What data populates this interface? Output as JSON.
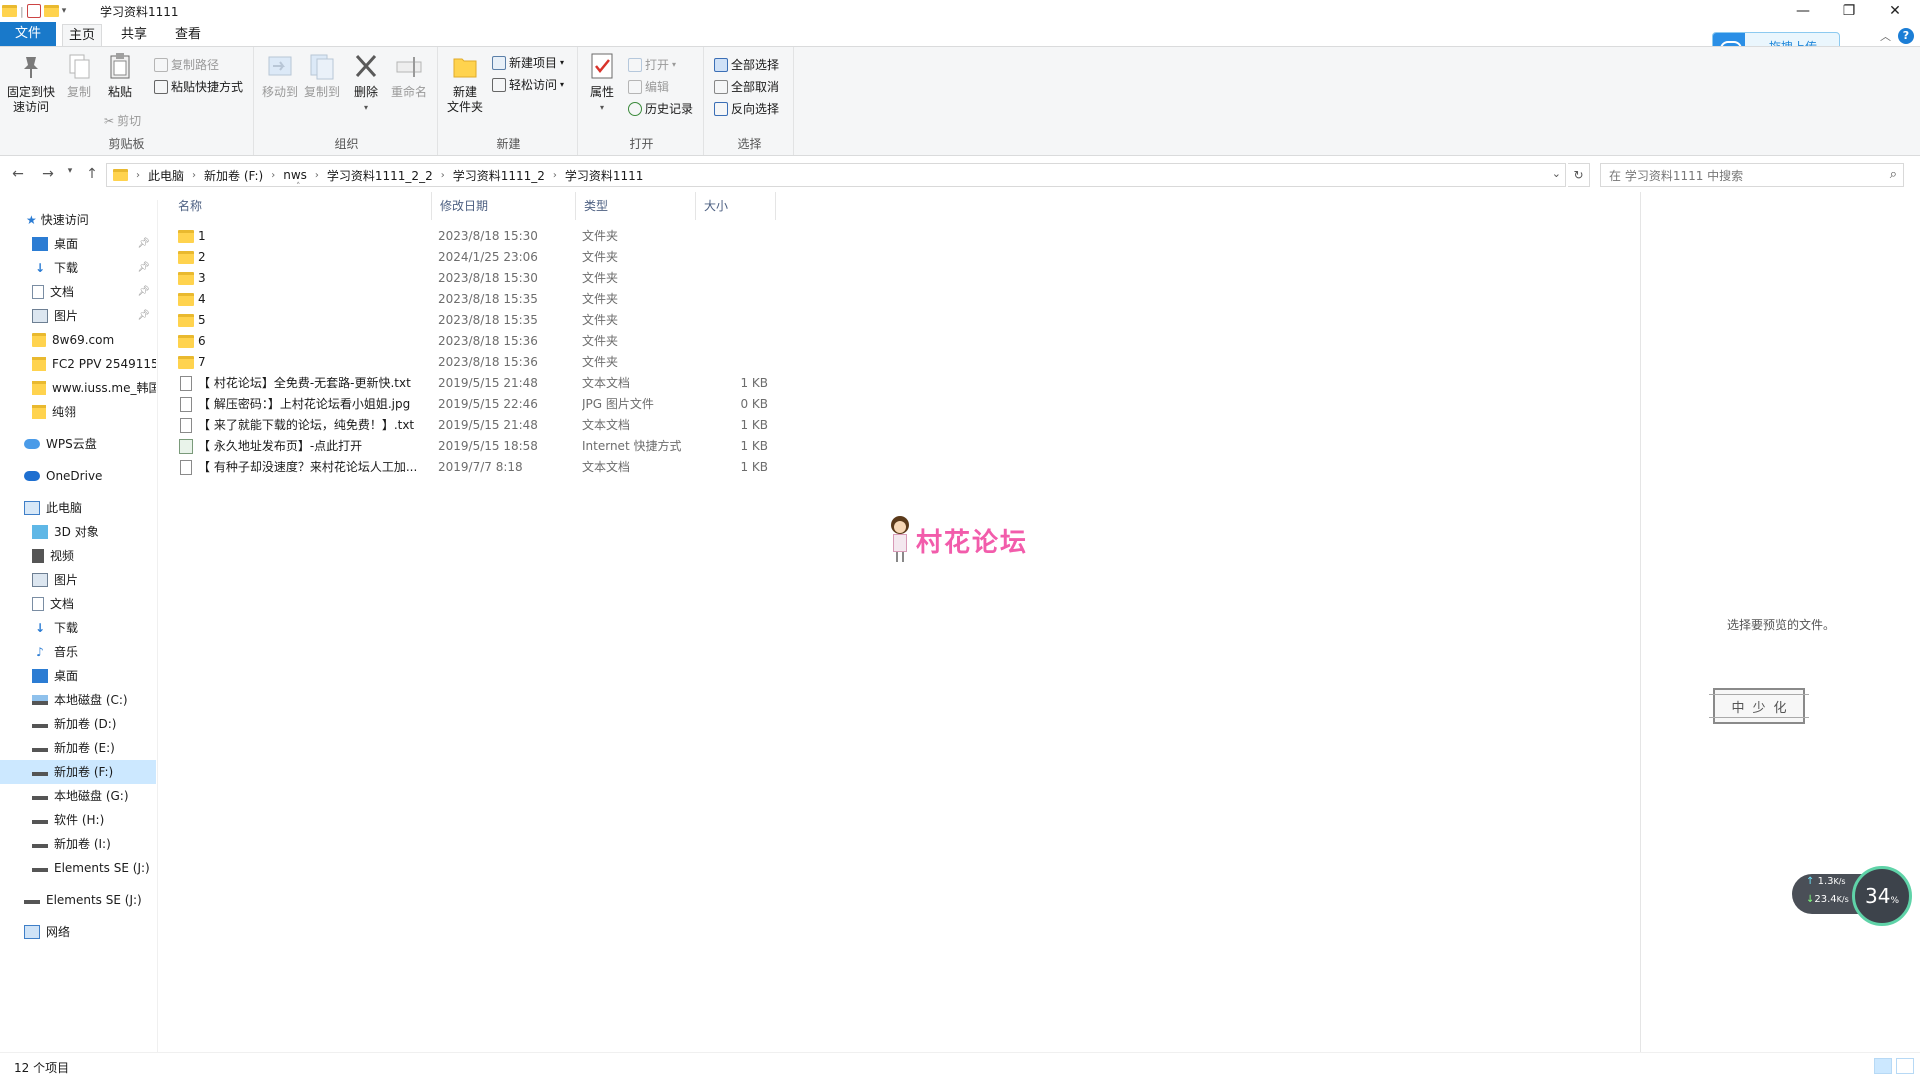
{
  "window": {
    "title": "学习资料1111",
    "minimize": "—",
    "maximize": "❐",
    "close": "✕"
  },
  "ribbon_tabs": [
    "文件",
    "主页",
    "共享",
    "查看"
  ],
  "ribbon": {
    "clipboard": {
      "label": "剪贴板",
      "pin_quick_access": "固定到快\n速访问",
      "copy": "复制",
      "paste": "粘贴",
      "copy_path": "复制路径",
      "paste_shortcut": "粘贴快捷方式",
      "cut": "剪切"
    },
    "organize": {
      "label": "组织",
      "move_to": "移动到",
      "copy_to": "复制到",
      "delete": "删除",
      "rename": "重命名"
    },
    "new": {
      "label": "新建",
      "new_folder": "新建\n文件夹",
      "new_item": "新建项目",
      "easy_access": "轻松访问"
    },
    "open": {
      "label": "打开",
      "properties": "属性",
      "open": "打开",
      "edit": "编辑",
      "history": "历史记录"
    },
    "select": {
      "label": "选择",
      "select_all": "全部选择",
      "select_none": "全部取消",
      "invert": "反向选择"
    }
  },
  "upload_button": "拖拽上传",
  "address": {
    "crumbs": [
      "此电脑",
      "新加卷 (F:)",
      "nws",
      "学习资料1111_2_2",
      "学习资料1111_2",
      "学习资料1111"
    ],
    "search_placeholder": "在 学习资料1111 中搜索"
  },
  "sidebar": {
    "quick_access": "快速访问",
    "quick_items": [
      {
        "label": "桌面",
        "pinned": true,
        "icon": "desktop-icon"
      },
      {
        "label": "下载",
        "pinned": true,
        "icon": "download-icon"
      },
      {
        "label": "文档",
        "pinned": true,
        "icon": "document-icon"
      },
      {
        "label": "图片",
        "pinned": true,
        "icon": "picture-icon"
      },
      {
        "label": "8w69.com",
        "pinned": false,
        "icon": "folder-icon"
      },
      {
        "label": "FC2 PPV 2549115",
        "pinned": false,
        "icon": "folder-icon"
      },
      {
        "label": "www.iuss.me_韩国",
        "pinned": false,
        "icon": "folder-icon"
      },
      {
        "label": "纯翎",
        "pinned": false,
        "icon": "folder-icon"
      }
    ],
    "wps_cloud": "WPS云盘",
    "onedrive": "OneDrive",
    "this_pc": "此电脑",
    "pc_items": [
      {
        "label": "3D 对象",
        "icon": "3d-objects-icon"
      },
      {
        "label": "视频",
        "icon": "video-icon"
      },
      {
        "label": "图片",
        "icon": "picture-icon"
      },
      {
        "label": "文档",
        "icon": "document-icon"
      },
      {
        "label": "下载",
        "icon": "download-icon"
      },
      {
        "label": "音乐",
        "icon": "music-icon"
      },
      {
        "label": "桌面",
        "icon": "desktop-icon"
      },
      {
        "label": "本地磁盘 (C:)",
        "icon": "system-drive-icon"
      },
      {
        "label": "新加卷 (D:)",
        "icon": "drive-icon"
      },
      {
        "label": "新加卷 (E:)",
        "icon": "drive-icon"
      },
      {
        "label": "新加卷 (F:)",
        "icon": "drive-icon",
        "selected": true
      },
      {
        "label": "本地磁盘 (G:)",
        "icon": "drive-icon"
      },
      {
        "label": "软件 (H:)",
        "icon": "drive-icon"
      },
      {
        "label": "新加卷 (I:)",
        "icon": "drive-icon"
      },
      {
        "label": "Elements SE (J:)",
        "icon": "drive-icon"
      }
    ],
    "external": "Elements SE (J:)",
    "network": "网络"
  },
  "columns": {
    "name": "名称",
    "date": "修改日期",
    "type": "类型",
    "size": "大小"
  },
  "files": [
    {
      "name": "1",
      "date": "2023/8/18 15:30",
      "type": "文件夹",
      "size": "",
      "kind": "folder"
    },
    {
      "name": "2",
      "date": "2024/1/25 23:06",
      "type": "文件夹",
      "size": "",
      "kind": "folder"
    },
    {
      "name": "3",
      "date": "2023/8/18 15:30",
      "type": "文件夹",
      "size": "",
      "kind": "folder"
    },
    {
      "name": "4",
      "date": "2023/8/18 15:35",
      "type": "文件夹",
      "size": "",
      "kind": "folder"
    },
    {
      "name": "5",
      "date": "2023/8/18 15:35",
      "type": "文件夹",
      "size": "",
      "kind": "folder"
    },
    {
      "name": "6",
      "date": "2023/8/18 15:36",
      "type": "文件夹",
      "size": "",
      "kind": "folder"
    },
    {
      "name": "7",
      "date": "2023/8/18 15:36",
      "type": "文件夹",
      "size": "",
      "kind": "folder"
    },
    {
      "name": "【 村花论坛】全免费-无套路-更新快.txt",
      "date": "2019/5/15 21:48",
      "type": "文本文档",
      "size": "1 KB",
      "kind": "doc"
    },
    {
      "name": "【 解压密码：】上村花论坛看小姐姐.jpg",
      "date": "2019/5/15 22:46",
      "type": "JPG 图片文件",
      "size": "0 KB",
      "kind": "doc"
    },
    {
      "name": "【 来了就能下载的论坛，纯免费！】.txt",
      "date": "2019/5/15 21:48",
      "type": "文本文档",
      "size": "1 KB",
      "kind": "doc"
    },
    {
      "name": "【 永久地址发布页】-点此打开",
      "date": "2019/5/15 18:58",
      "type": "Internet 快捷方式",
      "size": "1 KB",
      "kind": "link"
    },
    {
      "name": "【 有种子却没速度？来村花论坛人工加...",
      "date": "2019/7/7 8:18",
      "type": "文本文档",
      "size": "1 KB",
      "kind": "doc"
    }
  ],
  "watermark_logo": "村花论坛",
  "preview": {
    "message": "选择要预览的文件。",
    "seal_chars": [
      "中",
      "少",
      "化"
    ]
  },
  "network_widget": {
    "up_speed": "1.3",
    "up_unit": "K/s",
    "down_speed": "23.4",
    "down_unit": "K/s",
    "percent": "34",
    "percent_sign": "%"
  },
  "status": {
    "item_count": "12 个项目"
  }
}
